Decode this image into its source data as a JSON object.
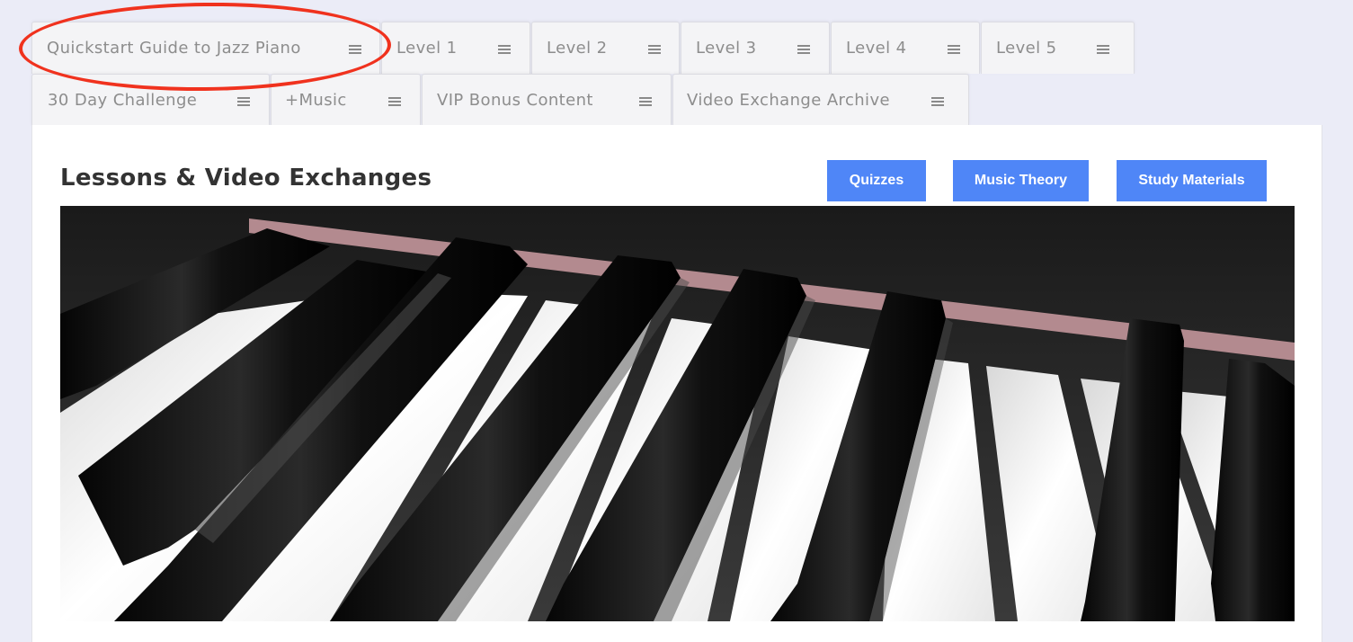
{
  "tabs_row1": [
    {
      "label": "Quickstart Guide to Jazz Piano"
    },
    {
      "label": "Level 1"
    },
    {
      "label": "Level 2"
    },
    {
      "label": "Level 3"
    },
    {
      "label": "Level 4"
    },
    {
      "label": "Level 5"
    }
  ],
  "tabs_row2": [
    {
      "label": "30 Day Challenge"
    },
    {
      "label": "+Music"
    },
    {
      "label": "VIP Bonus Content"
    },
    {
      "label": "Video Exchange Archive"
    }
  ],
  "content": {
    "title": "Lessons & Video Exchanges",
    "buttons": {
      "quizzes": "Quizzes",
      "music_theory": "Music Theory",
      "study_materials": "Study Materials"
    },
    "hero_image": "piano-keys-photo"
  },
  "colors": {
    "page_bg": "#ebecf7",
    "tab_bg": "#f4f4f6",
    "button_bg": "#4f86f7",
    "annotation": "#f0321e"
  },
  "icons": {
    "tab_menu": "hamburger-menu-icon"
  }
}
